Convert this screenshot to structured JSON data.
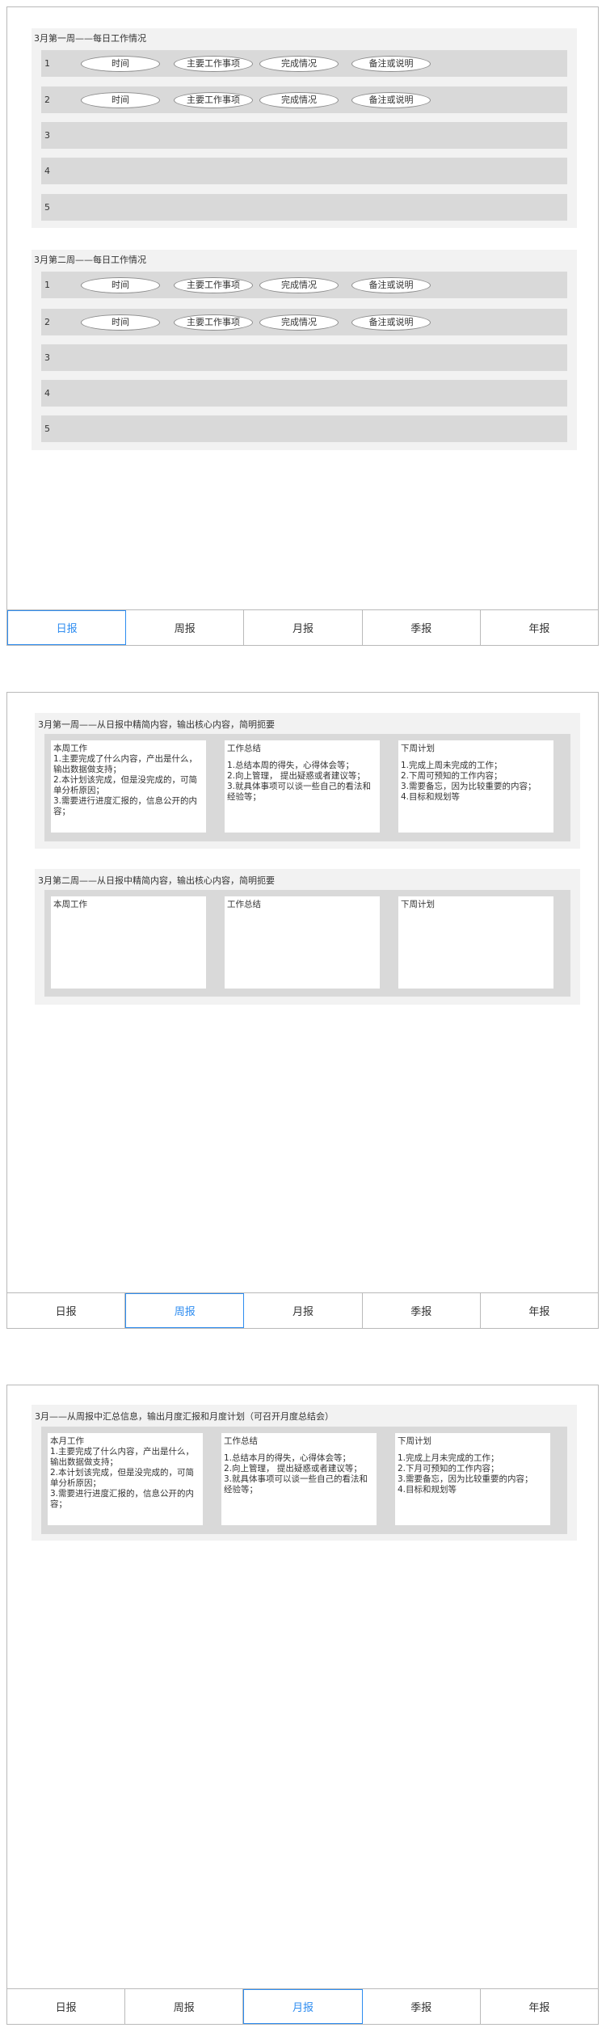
{
  "tabs": [
    "日报",
    "周报",
    "月报",
    "季报",
    "年报"
  ],
  "daily": {
    "panels": [
      {
        "title": "3月第一周——每日工作情况",
        "rows": [
          {
            "num": "1",
            "pills": [
              "时间",
              "主要工作事项",
              "完成情况",
              "备注或说明"
            ]
          },
          {
            "num": "2",
            "pills": [
              "时间",
              "主要工作事项",
              "完成情况",
              "备注或说明"
            ]
          },
          {
            "num": "3",
            "pills": []
          },
          {
            "num": "4",
            "pills": []
          },
          {
            "num": "5",
            "pills": []
          }
        ]
      },
      {
        "title": "3月第二周——每日工作情况",
        "rows": [
          {
            "num": "1",
            "pills": [
              "时间",
              "主要工作事项",
              "完成情况",
              "备注或说明"
            ]
          },
          {
            "num": "2",
            "pills": [
              "时间",
              "主要工作事项",
              "完成情况",
              "备注或说明"
            ]
          },
          {
            "num": "3",
            "pills": []
          },
          {
            "num": "4",
            "pills": []
          },
          {
            "num": "5",
            "pills": []
          }
        ]
      }
    ]
  },
  "weekly": {
    "panels": [
      {
        "title": "3月第一周——从日报中精简内容，输出核心内容，简明扼要",
        "cards": [
          {
            "head": "本周工作",
            "lines": [
              "1.主要完成了什么内容，产出是什么，输出数据做支持；",
              "2.本计划该完成，但是没完成的，可简单分析原因；",
              "3.需要进行进度汇报的，信息公开的内容；"
            ]
          },
          {
            "head": "工作总结",
            "lines": [
              "1.总结本周的得失，心得体会等；",
              "2.向上管理， 提出疑惑或者建议等；",
              "3.就具体事项可以谈一些自己的看法和经验等；"
            ]
          },
          {
            "head": "下周计划",
            "lines": [
              "1.完成上周未完成的工作；",
              "2.下周可预知的工作内容；",
              "3.需要备忘，因为比较重要的内容；",
              "4.目标和规划等"
            ]
          }
        ]
      },
      {
        "title": "3月第二周——从日报中精简内容，输出核心内容，简明扼要",
        "cards": [
          {
            "head": "本周工作",
            "lines": []
          },
          {
            "head": "工作总结",
            "lines": []
          },
          {
            "head": "下周计划",
            "lines": []
          }
        ]
      }
    ]
  },
  "monthly": {
    "panels": [
      {
        "title": "3月——从周报中汇总信息，输出月度汇报和月度计划（可召开月度总结会）",
        "cards": [
          {
            "head": "本月工作",
            "lines": [
              "1.主要完成了什么内容，产出是什么，输出数据做支持；",
              "2.本计划该完成，但是没完成的，可简单分析原因；",
              "3.需要进行进度汇报的，信息公开的内容；"
            ]
          },
          {
            "head": "工作总结",
            "lines": [
              "1.总结本月的得失，心得体会等；",
              "2.向上管理， 提出疑惑或者建议等；",
              "3.就具体事项可以谈一些自己的看法和经验等；"
            ]
          },
          {
            "head": "下周计划",
            "lines": [
              "1.完成上月未完成的工作；",
              "2.下月可预知的工作内容；",
              "3.需要备忘，因为比较重要的内容；",
              "4.目标和规划等"
            ]
          }
        ]
      }
    ]
  }
}
